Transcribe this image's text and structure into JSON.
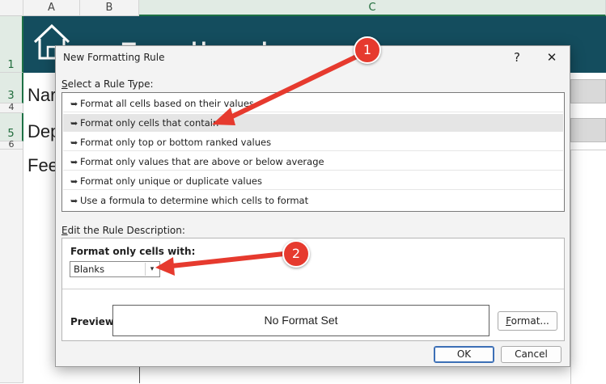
{
  "spreadsheet": {
    "columns": [
      "A",
      "B",
      "C"
    ],
    "rows": [
      "1",
      "3",
      "4",
      "5",
      "6"
    ],
    "banner_title": "Feedback",
    "cells": {
      "row3": "Nar",
      "row5": "Dep",
      "row6": "Fee"
    }
  },
  "dialog": {
    "title": "New Formatting Rule",
    "help_glyph": "?",
    "close_glyph": "✕",
    "rule_type_label_prefix": "S",
    "rule_type_label_rest": "elect a Rule Type:",
    "rule_types": [
      "Format all cells based on their values",
      "Format only cells that contain",
      "Format only top or bottom ranked values",
      "Format only values that are above or below average",
      "Format only unique or duplicate values",
      "Use a formula to determine which cells to format"
    ],
    "selected_rule_index": 1,
    "edit_label_prefix": "E",
    "edit_label_rest": "dit the Rule Description:",
    "format_only_label": "Format only cells with:",
    "condition_value": "Blanks",
    "preview_label": "Preview:",
    "preview_text": "No Format Set",
    "format_button_prefix": "F",
    "format_button_rest": "ormat...",
    "ok_label": "OK",
    "cancel_label": "Cancel"
  },
  "annotations": {
    "badge1": "1",
    "badge2": "2",
    "accent_color": "#e63a2e"
  }
}
